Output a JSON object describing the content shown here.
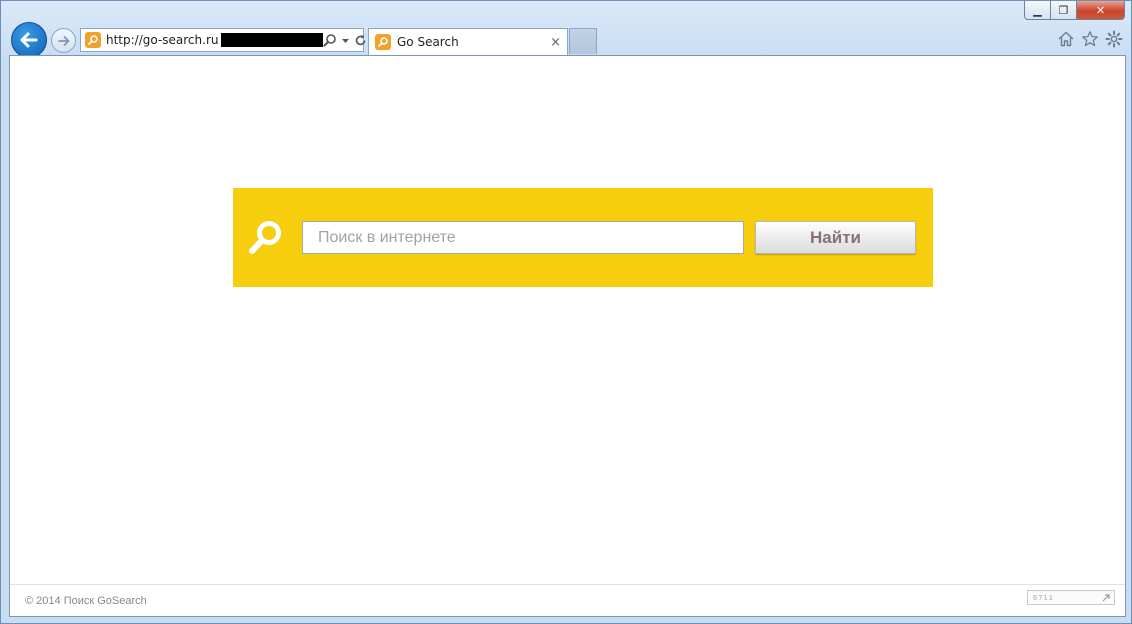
{
  "browser": {
    "url_visible": "http://go-search.ru",
    "tab_title": "Go Search",
    "tab_close_glyph": "×",
    "window_controls": {
      "minimize": "▁",
      "maximize": "❐",
      "close": "✕"
    }
  },
  "search": {
    "placeholder": "Поиск в интернете",
    "value": "",
    "button_label": "Найти"
  },
  "footer": {
    "copyright": "© 2014   Поиск GoSearch",
    "counter_text": "6711"
  },
  "colors": {
    "panel_yellow": "#f7ce0d",
    "button_text": "#8a7077",
    "back_button_blue": "#1272cc"
  },
  "icons": {
    "back": "back-arrow-icon",
    "forward": "forward-arrow-icon",
    "site_favicon": "magnifier-favicon-icon",
    "address_search": "search-icon",
    "dropdown": "chevron-down-icon",
    "refresh": "refresh-icon",
    "home": "home-icon",
    "favorites": "star-icon",
    "tools": "gear-icon",
    "panel_search": "magnifier-icon"
  }
}
